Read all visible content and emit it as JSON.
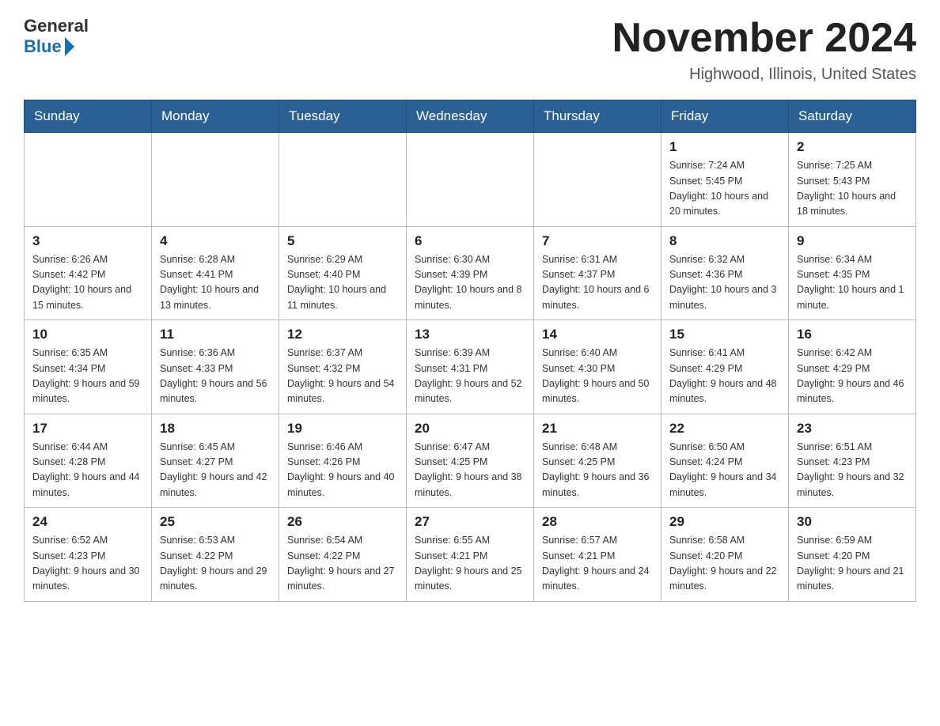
{
  "logo": {
    "general": "General",
    "blue": "Blue"
  },
  "header": {
    "title": "November 2024",
    "subtitle": "Highwood, Illinois, United States"
  },
  "weekdays": [
    "Sunday",
    "Monday",
    "Tuesday",
    "Wednesday",
    "Thursday",
    "Friday",
    "Saturday"
  ],
  "weeks": [
    [
      {
        "day": "",
        "info": ""
      },
      {
        "day": "",
        "info": ""
      },
      {
        "day": "",
        "info": ""
      },
      {
        "day": "",
        "info": ""
      },
      {
        "day": "",
        "info": ""
      },
      {
        "day": "1",
        "info": "Sunrise: 7:24 AM\nSunset: 5:45 PM\nDaylight: 10 hours and 20 minutes."
      },
      {
        "day": "2",
        "info": "Sunrise: 7:25 AM\nSunset: 5:43 PM\nDaylight: 10 hours and 18 minutes."
      }
    ],
    [
      {
        "day": "3",
        "info": "Sunrise: 6:26 AM\nSunset: 4:42 PM\nDaylight: 10 hours and 15 minutes."
      },
      {
        "day": "4",
        "info": "Sunrise: 6:28 AM\nSunset: 4:41 PM\nDaylight: 10 hours and 13 minutes."
      },
      {
        "day": "5",
        "info": "Sunrise: 6:29 AM\nSunset: 4:40 PM\nDaylight: 10 hours and 11 minutes."
      },
      {
        "day": "6",
        "info": "Sunrise: 6:30 AM\nSunset: 4:39 PM\nDaylight: 10 hours and 8 minutes."
      },
      {
        "day": "7",
        "info": "Sunrise: 6:31 AM\nSunset: 4:37 PM\nDaylight: 10 hours and 6 minutes."
      },
      {
        "day": "8",
        "info": "Sunrise: 6:32 AM\nSunset: 4:36 PM\nDaylight: 10 hours and 3 minutes."
      },
      {
        "day": "9",
        "info": "Sunrise: 6:34 AM\nSunset: 4:35 PM\nDaylight: 10 hours and 1 minute."
      }
    ],
    [
      {
        "day": "10",
        "info": "Sunrise: 6:35 AM\nSunset: 4:34 PM\nDaylight: 9 hours and 59 minutes."
      },
      {
        "day": "11",
        "info": "Sunrise: 6:36 AM\nSunset: 4:33 PM\nDaylight: 9 hours and 56 minutes."
      },
      {
        "day": "12",
        "info": "Sunrise: 6:37 AM\nSunset: 4:32 PM\nDaylight: 9 hours and 54 minutes."
      },
      {
        "day": "13",
        "info": "Sunrise: 6:39 AM\nSunset: 4:31 PM\nDaylight: 9 hours and 52 minutes."
      },
      {
        "day": "14",
        "info": "Sunrise: 6:40 AM\nSunset: 4:30 PM\nDaylight: 9 hours and 50 minutes."
      },
      {
        "day": "15",
        "info": "Sunrise: 6:41 AM\nSunset: 4:29 PM\nDaylight: 9 hours and 48 minutes."
      },
      {
        "day": "16",
        "info": "Sunrise: 6:42 AM\nSunset: 4:29 PM\nDaylight: 9 hours and 46 minutes."
      }
    ],
    [
      {
        "day": "17",
        "info": "Sunrise: 6:44 AM\nSunset: 4:28 PM\nDaylight: 9 hours and 44 minutes."
      },
      {
        "day": "18",
        "info": "Sunrise: 6:45 AM\nSunset: 4:27 PM\nDaylight: 9 hours and 42 minutes."
      },
      {
        "day": "19",
        "info": "Sunrise: 6:46 AM\nSunset: 4:26 PM\nDaylight: 9 hours and 40 minutes."
      },
      {
        "day": "20",
        "info": "Sunrise: 6:47 AM\nSunset: 4:25 PM\nDaylight: 9 hours and 38 minutes."
      },
      {
        "day": "21",
        "info": "Sunrise: 6:48 AM\nSunset: 4:25 PM\nDaylight: 9 hours and 36 minutes."
      },
      {
        "day": "22",
        "info": "Sunrise: 6:50 AM\nSunset: 4:24 PM\nDaylight: 9 hours and 34 minutes."
      },
      {
        "day": "23",
        "info": "Sunrise: 6:51 AM\nSunset: 4:23 PM\nDaylight: 9 hours and 32 minutes."
      }
    ],
    [
      {
        "day": "24",
        "info": "Sunrise: 6:52 AM\nSunset: 4:23 PM\nDaylight: 9 hours and 30 minutes."
      },
      {
        "day": "25",
        "info": "Sunrise: 6:53 AM\nSunset: 4:22 PM\nDaylight: 9 hours and 29 minutes."
      },
      {
        "day": "26",
        "info": "Sunrise: 6:54 AM\nSunset: 4:22 PM\nDaylight: 9 hours and 27 minutes."
      },
      {
        "day": "27",
        "info": "Sunrise: 6:55 AM\nSunset: 4:21 PM\nDaylight: 9 hours and 25 minutes."
      },
      {
        "day": "28",
        "info": "Sunrise: 6:57 AM\nSunset: 4:21 PM\nDaylight: 9 hours and 24 minutes."
      },
      {
        "day": "29",
        "info": "Sunrise: 6:58 AM\nSunset: 4:20 PM\nDaylight: 9 hours and 22 minutes."
      },
      {
        "day": "30",
        "info": "Sunrise: 6:59 AM\nSunset: 4:20 PM\nDaylight: 9 hours and 21 minutes."
      }
    ]
  ]
}
